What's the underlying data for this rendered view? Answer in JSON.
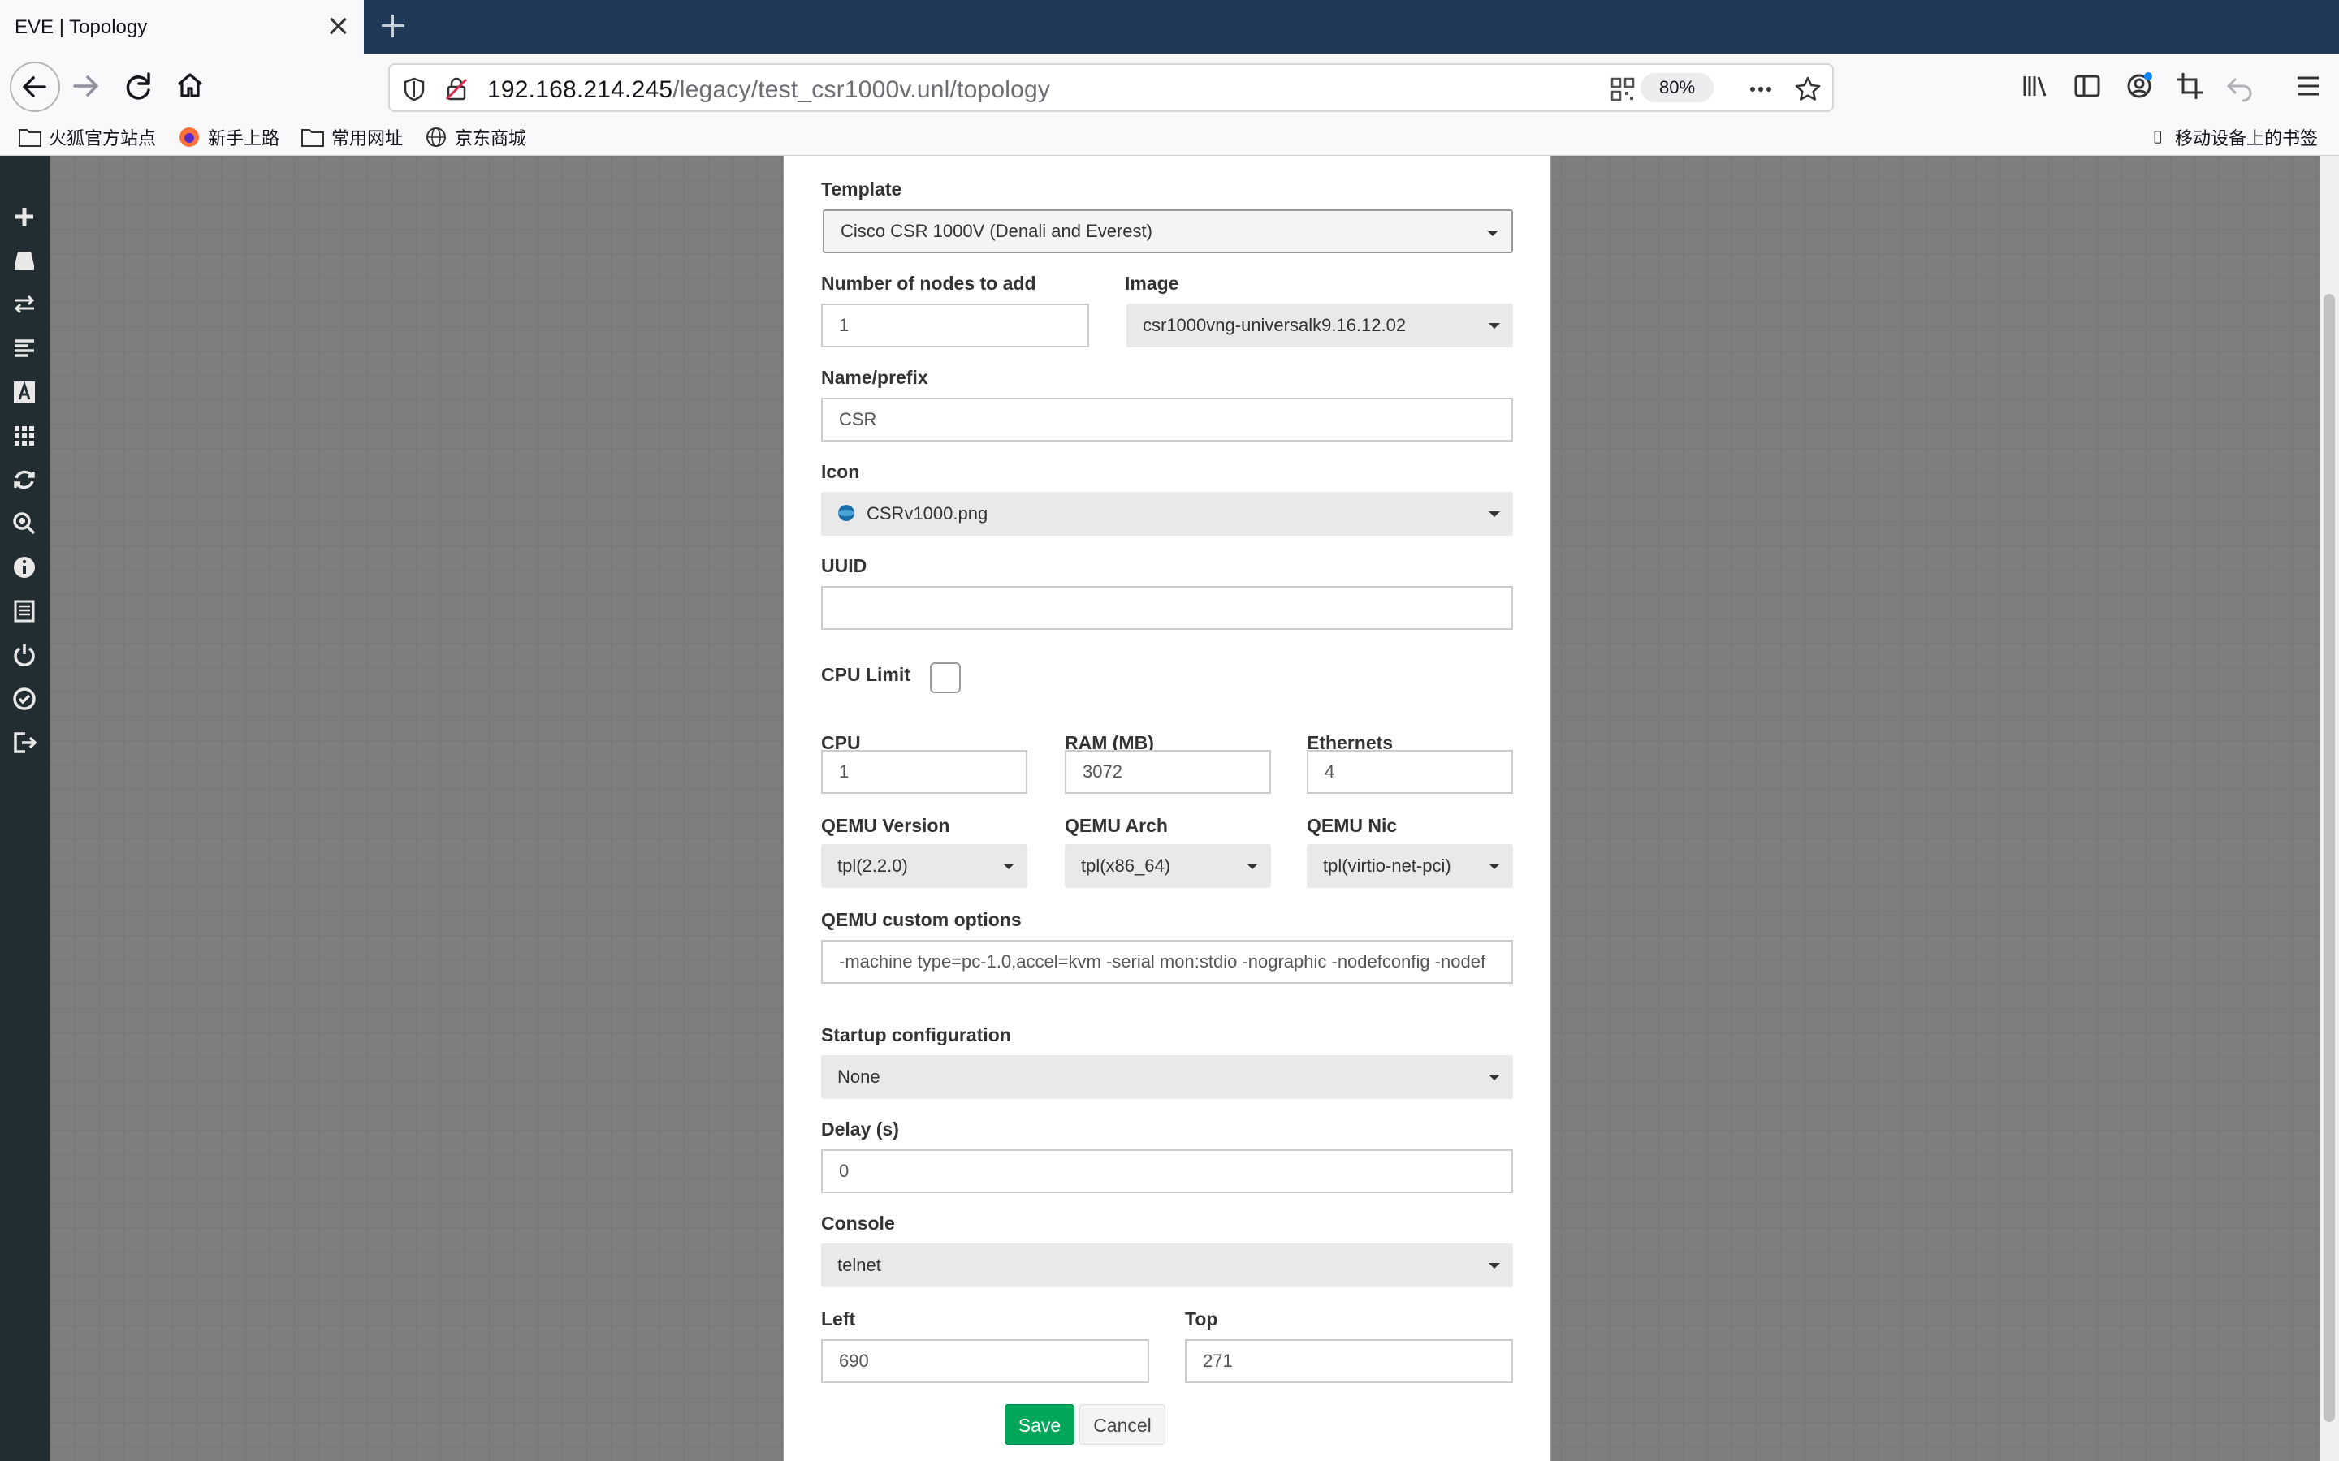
{
  "browser": {
    "tab_title": "EVE | Topology",
    "url_host": "192.168.214.245",
    "url_path": "/legacy/test_csr1000v.unl/topology",
    "zoom": "80%",
    "bookmarks": [
      "火狐官方站点",
      "新手上路",
      "常用网址",
      "京东商城"
    ],
    "mobile_bookmarks": "移动设备上的书签"
  },
  "form": {
    "template": {
      "label": "Template",
      "value": "Cisco CSR 1000V (Denali and Everest)"
    },
    "nodes": {
      "label": "Number of nodes to add",
      "value": "1"
    },
    "image": {
      "label": "Image",
      "value": "csr1000vng-universalk9.16.12.02"
    },
    "name": {
      "label": "Name/prefix",
      "value": "CSR"
    },
    "icon": {
      "label": "Icon",
      "value": "CSRv1000.png"
    },
    "uuid": {
      "label": "UUID",
      "value": ""
    },
    "cpu_limit": {
      "label": "CPU Limit",
      "checked": false
    },
    "cpu": {
      "label": "CPU",
      "value": "1"
    },
    "ram": {
      "label": "RAM (MB)",
      "value": "3072"
    },
    "ethernets": {
      "label": "Ethernets",
      "value": "4"
    },
    "qemu_version": {
      "label": "QEMU Version",
      "value": "tpl(2.2.0)"
    },
    "qemu_arch": {
      "label": "QEMU Arch",
      "value": "tpl(x86_64)"
    },
    "qemu_nic": {
      "label": "QEMU Nic",
      "value": "tpl(virtio-net-pci)"
    },
    "qemu_options": {
      "label": "QEMU custom options",
      "value": "-machine type=pc-1.0,accel=kvm -serial mon:stdio -nographic -nodefconfig -nodef"
    },
    "startup": {
      "label": "Startup configuration",
      "value": "None"
    },
    "delay": {
      "label": "Delay (s)",
      "value": "0"
    },
    "console": {
      "label": "Console",
      "value": "telnet"
    },
    "left": {
      "label": "Left",
      "value": "690"
    },
    "top": {
      "label": "Top",
      "value": "271"
    },
    "save_label": "Save",
    "cancel_label": "Cancel"
  },
  "sidebar_icons": [
    "add-icon",
    "storage-icon",
    "network-icon",
    "list-icon",
    "text-icon",
    "grid-icon",
    "refresh-icon",
    "zoom-icon",
    "info-icon",
    "notes-icon",
    "power-icon",
    "check-icon",
    "logout-icon"
  ],
  "colors": {
    "save": "#00a65a",
    "sidebar": "#222d32",
    "tabbar": "#1f3956"
  }
}
